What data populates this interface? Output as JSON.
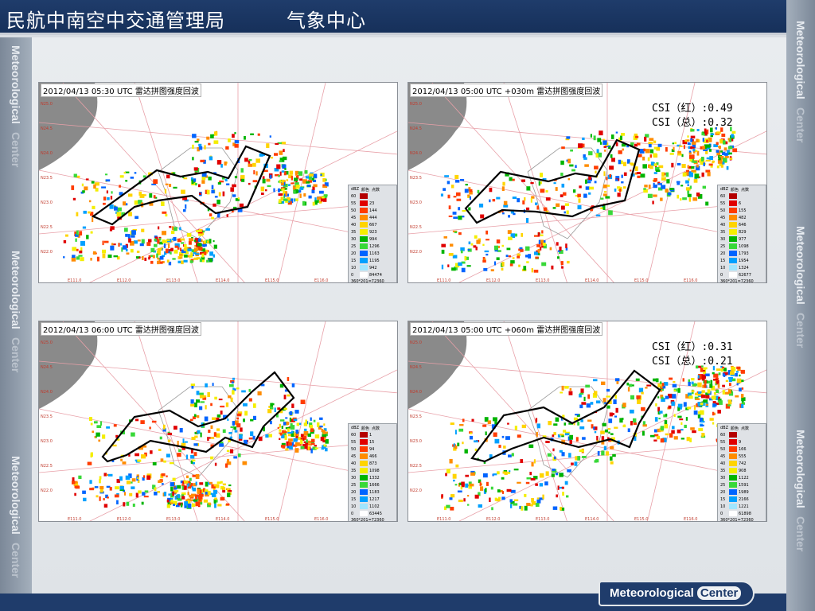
{
  "header": {
    "title": "民航中南空中交通管理局",
    "subtitle": "气象中心"
  },
  "side_label": "Meteorological",
  "side_label_faded": "Center",
  "footer": {
    "left": "Meteorological",
    "right": "Center"
  },
  "colors": {
    "brand": "#1f3c6b",
    "boundary": "#000000",
    "lon_lat_label": "#c0392b"
  },
  "legend_header": [
    "dBZ",
    "颜色",
    "点数"
  ],
  "legend_levels": [
    "60",
    "55",
    "50",
    "45",
    "40",
    "35",
    "30",
    "25",
    "20",
    "15",
    "10",
    "0"
  ],
  "legend_colors": [
    "#b40000",
    "#e00000",
    "#ff3c00",
    "#ff8c00",
    "#ffd400",
    "#f4ee00",
    "#00b400",
    "#38d838",
    "#0064ff",
    "#00a0ff",
    "#a0e6ff",
    "#ffffff"
  ],
  "lon_labels": [
    "E111.0",
    "E112.0",
    "E113.0",
    "E114.0",
    "E115.0",
    "E116.0"
  ],
  "lat_labels": [
    "N25.0",
    "N24.5",
    "N24.0",
    "N23.5",
    "N23.0",
    "N22.5",
    "N22.0"
  ],
  "panels": [
    {
      "title": "2012/04/13 05:30 UTC 雷达拼图强度回波",
      "csi_red": "",
      "csi_total": "",
      "legend_counts": [
        "",
        "23",
        "144",
        "444",
        "667",
        "923",
        "994",
        "1296",
        "1163",
        "1195",
        "942",
        "84474"
      ],
      "legend_footer": "360*201=72360"
    },
    {
      "title": "2012/04/13 05:00 UTC +030m 雷达拼图强度回波",
      "csi_red": "CSI（红）:0.49",
      "csi_total": "CSI（总）:0.32",
      "legend_counts": [
        "",
        "6",
        "155",
        "482",
        "646",
        "829",
        "977",
        "1098",
        "1793",
        "1954",
        "1324",
        "62677"
      ],
      "legend_footer": "360*201=72360"
    },
    {
      "title": "2012/04/13 06:00 UTC 雷达拼图强度回波",
      "csi_red": "",
      "csi_total": "",
      "legend_counts": [
        "1",
        "15",
        "94",
        "466",
        "873",
        "1098",
        "1332",
        "1666",
        "1183",
        "1217",
        "1102",
        "63445"
      ],
      "legend_footer": "360*201=72360"
    },
    {
      "title": "2012/04/13 05:00 UTC +060m 雷达拼图强度回波",
      "csi_red": "CSI（红）:0.31",
      "csi_total": "CSI（总）:0.21",
      "legend_counts": [
        "",
        "9",
        "166",
        "555",
        "742",
        "908",
        "1122",
        "1591",
        "1989",
        "2166",
        "1221",
        "61898"
      ],
      "legend_footer": "360*201=72360"
    }
  ]
}
